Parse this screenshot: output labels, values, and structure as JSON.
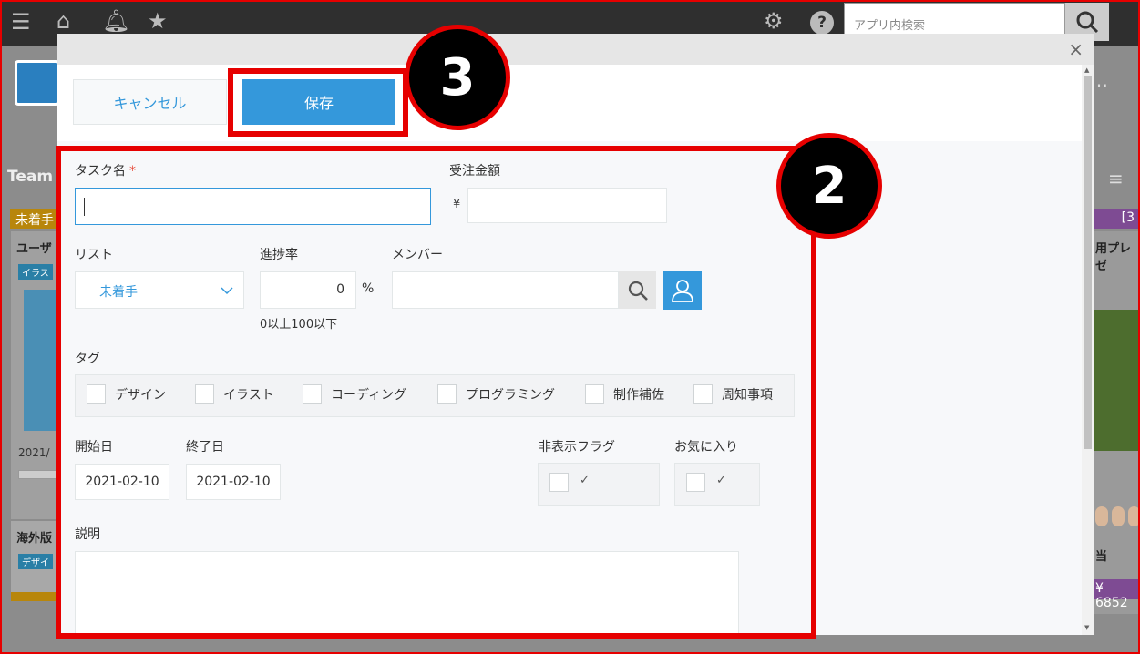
{
  "background": {
    "search_placeholder": "アプリ内検索",
    "team_label": "Team",
    "status_left": "未着手",
    "status_right": "[3",
    "card_left_title": "ユーザ",
    "card_left_tag": "イラス",
    "card_left_date": "2021/",
    "card_left2_title": "海外版",
    "card_left2_tag": "デザイ",
    "card_right_title": "用プレゼ",
    "card_right_owner": "当",
    "card_right_price": "¥ 6852",
    "more": "…"
  },
  "modal": {
    "close_icon": "×",
    "cancel_label": "キャンセル",
    "save_label": "保存",
    "fields": {
      "task_name_label": "タスク名",
      "required_mark": "*",
      "task_name_value": "",
      "amount_label": "受注金額",
      "currency": "¥",
      "amount_value": "",
      "list_label": "リスト",
      "list_value": "未着手",
      "progress_label": "進捗率",
      "progress_value": "0",
      "progress_unit": "%",
      "progress_hint": "0以上100以下",
      "member_label": "メンバー",
      "member_value": "",
      "tag_label": "タグ",
      "tags": [
        "デザイン",
        "イラスト",
        "コーディング",
        "プログラミング",
        "制作補佐",
        "周知事項"
      ],
      "start_label": "開始日",
      "start_value": "2021-02-10",
      "end_label": "終了日",
      "end_value": "2021-02-10",
      "hidden_flag_label": "非表示フラグ",
      "favorite_label": "お気に入り",
      "check_mark": "✓",
      "description_label": "説明",
      "description_value": ""
    }
  },
  "annotations": {
    "badge_form": "2",
    "badge_save": "3"
  },
  "colors": {
    "accent": "#3498db",
    "annotation_red": "#e60000",
    "required": "#e74c3c"
  }
}
